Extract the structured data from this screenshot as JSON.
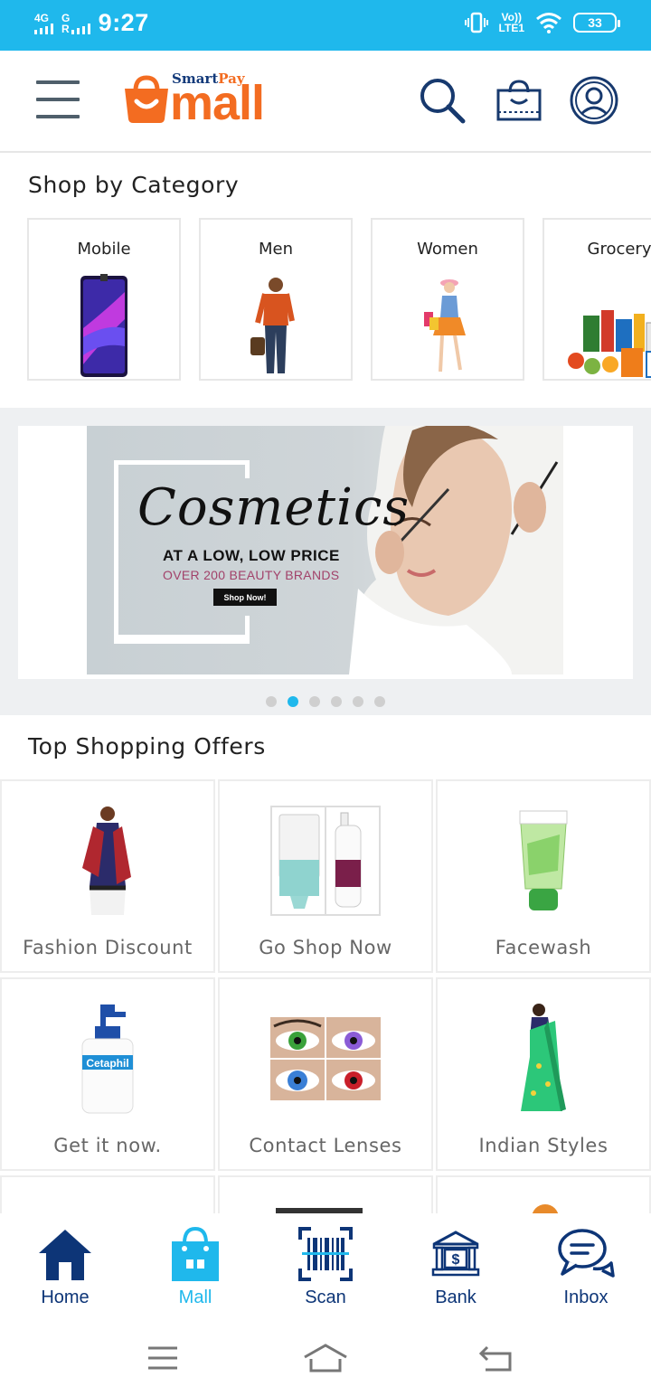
{
  "status_bar": {
    "network_1": "4G",
    "network_2": "G",
    "network_2_sub": "R",
    "time": "9:27",
    "volte_top": "Vo))",
    "volte_bottom": "LTE1",
    "battery": "33"
  },
  "header": {
    "brand_small_a": "Smart",
    "brand_small_b": "Pay",
    "brand_big": "mall"
  },
  "categories": {
    "title": "Shop by Category",
    "items": [
      {
        "label": "Mobile",
        "icon": "phone-image"
      },
      {
        "label": "Men",
        "icon": "man-image"
      },
      {
        "label": "Women",
        "icon": "woman-image"
      },
      {
        "label": "Grocery",
        "icon": "grocery-image"
      }
    ]
  },
  "banner": {
    "title": "Cosmetics",
    "line1": "AT A LOW, LOW PRICE",
    "line2": "OVER 200 BEAUTY BRANDS",
    "button": "Shop Now!",
    "slide_count": 6,
    "active_slide": 2
  },
  "offers": {
    "title": "Top Shopping Offers",
    "items": [
      {
        "label": "Fashion Discount",
        "icon": "kurti-image"
      },
      {
        "label": "Go Shop Now",
        "icon": "lotion-bottles-image"
      },
      {
        "label": "Facewash",
        "icon": "facewash-tube-image"
      },
      {
        "label": "Get it now.",
        "icon": "cetaphil-bottle-image",
        "brand": "Cetaphil"
      },
      {
        "label": "Contact Lenses",
        "icon": "colored-eyes-image"
      },
      {
        "label": "Indian Styles",
        "icon": "saree-image"
      }
    ]
  },
  "bottom_nav": {
    "items": [
      {
        "label": "Home",
        "icon": "home-icon"
      },
      {
        "label": "Mall",
        "icon": "shopping-bag-icon"
      },
      {
        "label": "Scan",
        "icon": "barcode-scan-icon"
      },
      {
        "label": "Bank",
        "icon": "bank-icon"
      },
      {
        "label": "Inbox",
        "icon": "chat-icon"
      }
    ],
    "active": "Mall"
  },
  "colors": {
    "accent": "#1fb8ec",
    "brand_orange": "#f36c21",
    "nav_blue": "#0d3577"
  }
}
